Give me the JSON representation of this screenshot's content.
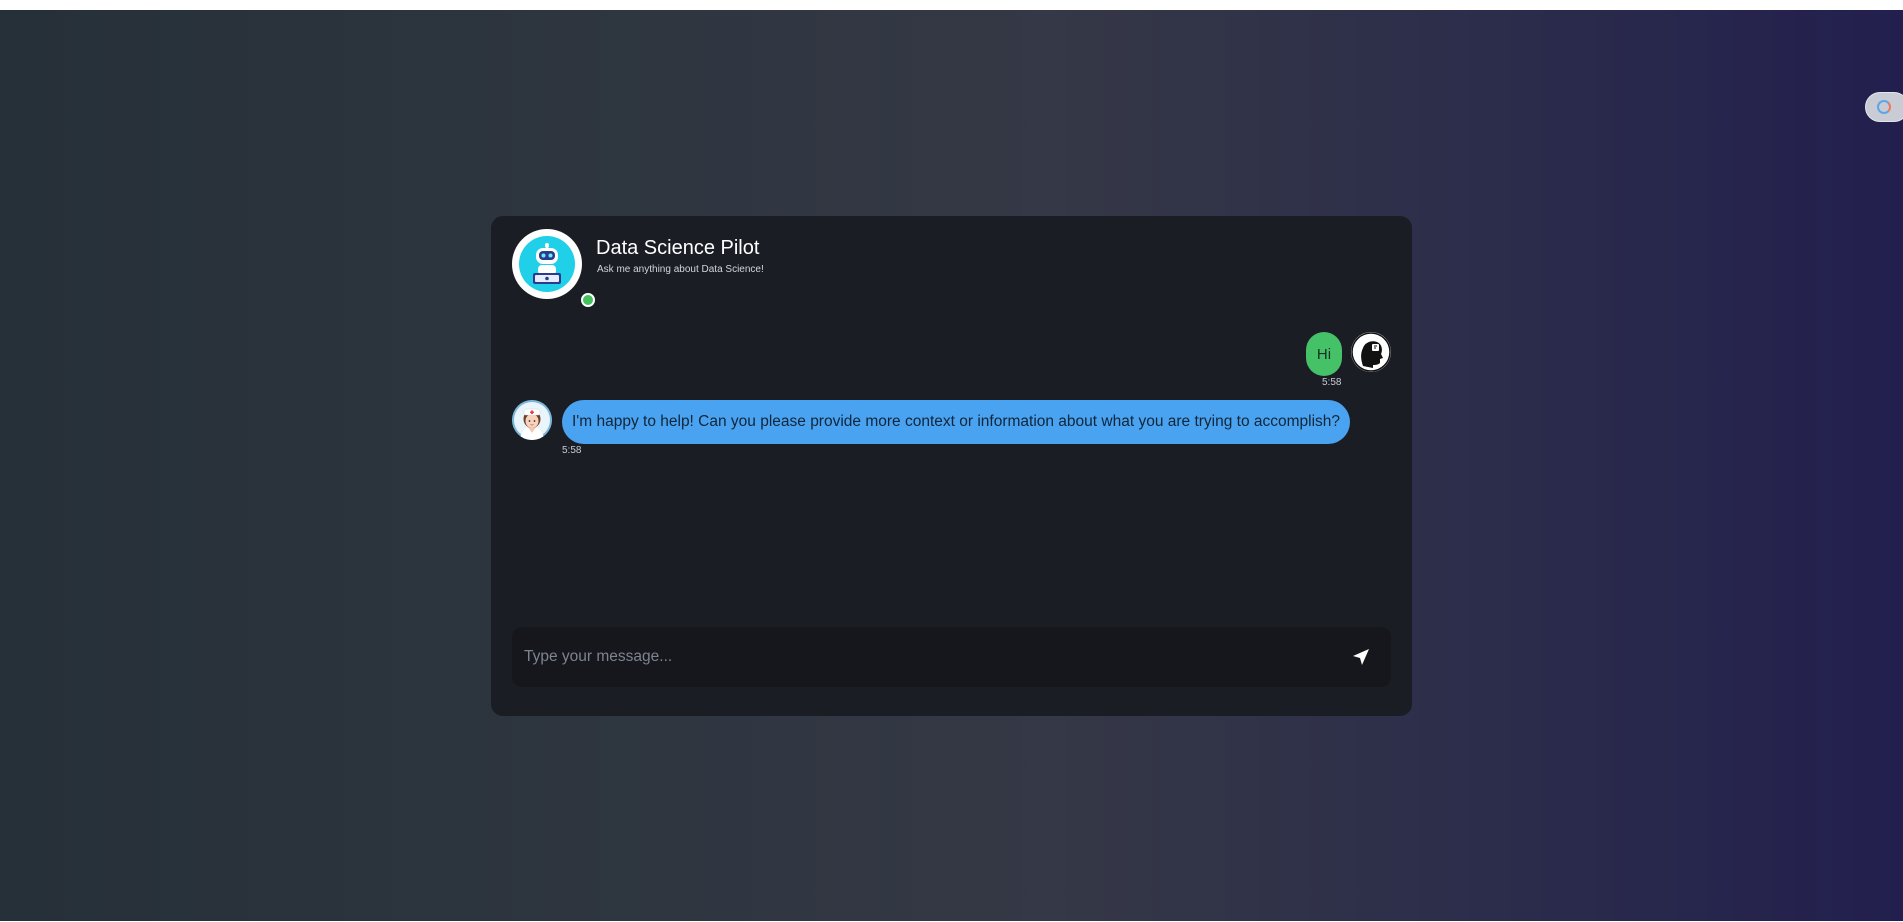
{
  "header": {
    "title": "Data Science Pilot",
    "subtitle": "Ask me anything about Data Science!",
    "status": "online"
  },
  "messages": [
    {
      "sender": "user",
      "text": "Hi",
      "time": "5:58"
    },
    {
      "sender": "bot",
      "text": "I'm happy to help! Can you please provide more context or information about what you are trying to accomplish?",
      "time": "5:58"
    }
  ],
  "composer": {
    "placeholder": "Type your message...",
    "value": ""
  },
  "icons": {
    "send": "send-icon",
    "header_avatar": "robot-avatar",
    "user_avatar": "user-avatar",
    "bot_avatar": "nurse-avatar"
  },
  "colors": {
    "user_bubble": "#45c168",
    "bot_bubble": "#4aa3f0",
    "card": "#1b1d25",
    "online": "#43c15a"
  }
}
